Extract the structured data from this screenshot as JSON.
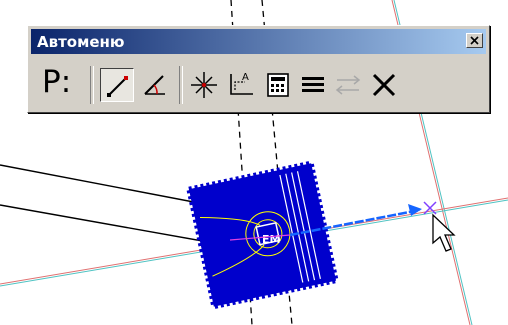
{
  "toolbar": {
    "title": "Автоменю",
    "mode_label": "P:",
    "buttons": [
      {
        "name": "line-by-two-points",
        "icon": "line-two-points-icon",
        "pressed": true
      },
      {
        "name": "line-by-angle",
        "icon": "line-angle-icon",
        "pressed": false
      },
      {
        "name": "snap-point",
        "icon": "snap-point-icon",
        "pressed": false
      },
      {
        "name": "axis-label",
        "icon": "axis-label-icon",
        "pressed": false
      },
      {
        "name": "calculator",
        "icon": "calculator-icon",
        "pressed": false
      },
      {
        "name": "line-style",
        "icon": "line-style-icon",
        "pressed": false
      },
      {
        "name": "swap-direction",
        "icon": "swap-arrows-icon",
        "pressed": false
      },
      {
        "name": "cancel",
        "icon": "close-x-icon",
        "pressed": false
      }
    ],
    "close_icon": "close-icon"
  },
  "colors": {
    "title_gradient_start": "#0a246a",
    "title_gradient_end": "#a6caf0",
    "panel": "#d4d0c8",
    "object_fill": "#0000cc",
    "guide_line": "#e07070",
    "axis_line": "#4fc3c3",
    "active_vector": "#1565ff"
  },
  "canvas": {
    "cursor_icon": "mouse-pointer-icon",
    "object_label": "EM"
  }
}
